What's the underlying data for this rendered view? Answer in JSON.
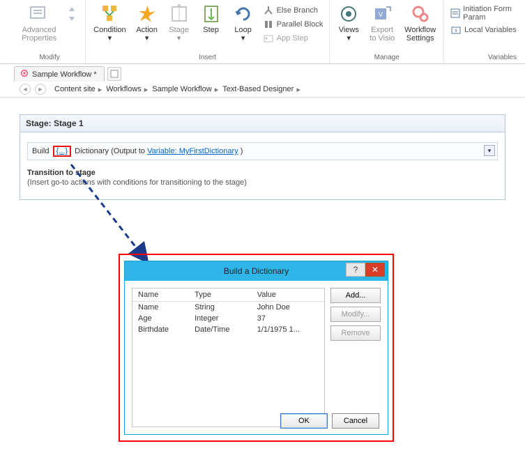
{
  "ribbon": {
    "groups": {
      "modify": {
        "title": "Modify",
        "advanced": "Advanced\nProperties"
      },
      "insert": {
        "title": "Insert",
        "condition": "Condition",
        "action": "Action",
        "stage": "Stage",
        "step": "Step",
        "loop": "Loop",
        "else_branch": "Else Branch",
        "parallel_block": "Parallel Block",
        "app_step": "App Step"
      },
      "manage": {
        "title": "Manage",
        "views": "Views",
        "export": "Export\nto Visio",
        "settings": "Workflow\nSettings"
      },
      "variables": {
        "title": "Variables",
        "init_form": "Initiation Form Param",
        "local_vars": "Local Variables"
      }
    }
  },
  "tab": {
    "label": "Sample Workflow *"
  },
  "breadcrumbs": [
    "Content site",
    "Workflows",
    "Sample Workflow",
    "Text-Based Designer"
  ],
  "stage": {
    "title": "Stage: Stage 1",
    "action_prefix": "Build",
    "action_dots": "{...}",
    "action_mid": "Dictionary (Output to ",
    "action_var": "Variable: MyFirstDictionary",
    "action_suffix": " )",
    "transition_title": "Transition to stage",
    "transition_hint": "(Insert go-to actions with conditions for transitioning to the stage)"
  },
  "dialog": {
    "title": "Build a Dictionary",
    "cols": [
      "Name",
      "Type",
      "Value"
    ],
    "rows": [
      {
        "name": "Name",
        "type": "String",
        "value": "John Doe"
      },
      {
        "name": "Age",
        "type": "Integer",
        "value": "37"
      },
      {
        "name": "Birthdate",
        "type": "Date/Time",
        "value": "1/1/1975 1..."
      }
    ],
    "buttons": {
      "add": "Add...",
      "modify": "Modify...",
      "remove": "Remove",
      "ok": "OK",
      "cancel": "Cancel"
    }
  }
}
